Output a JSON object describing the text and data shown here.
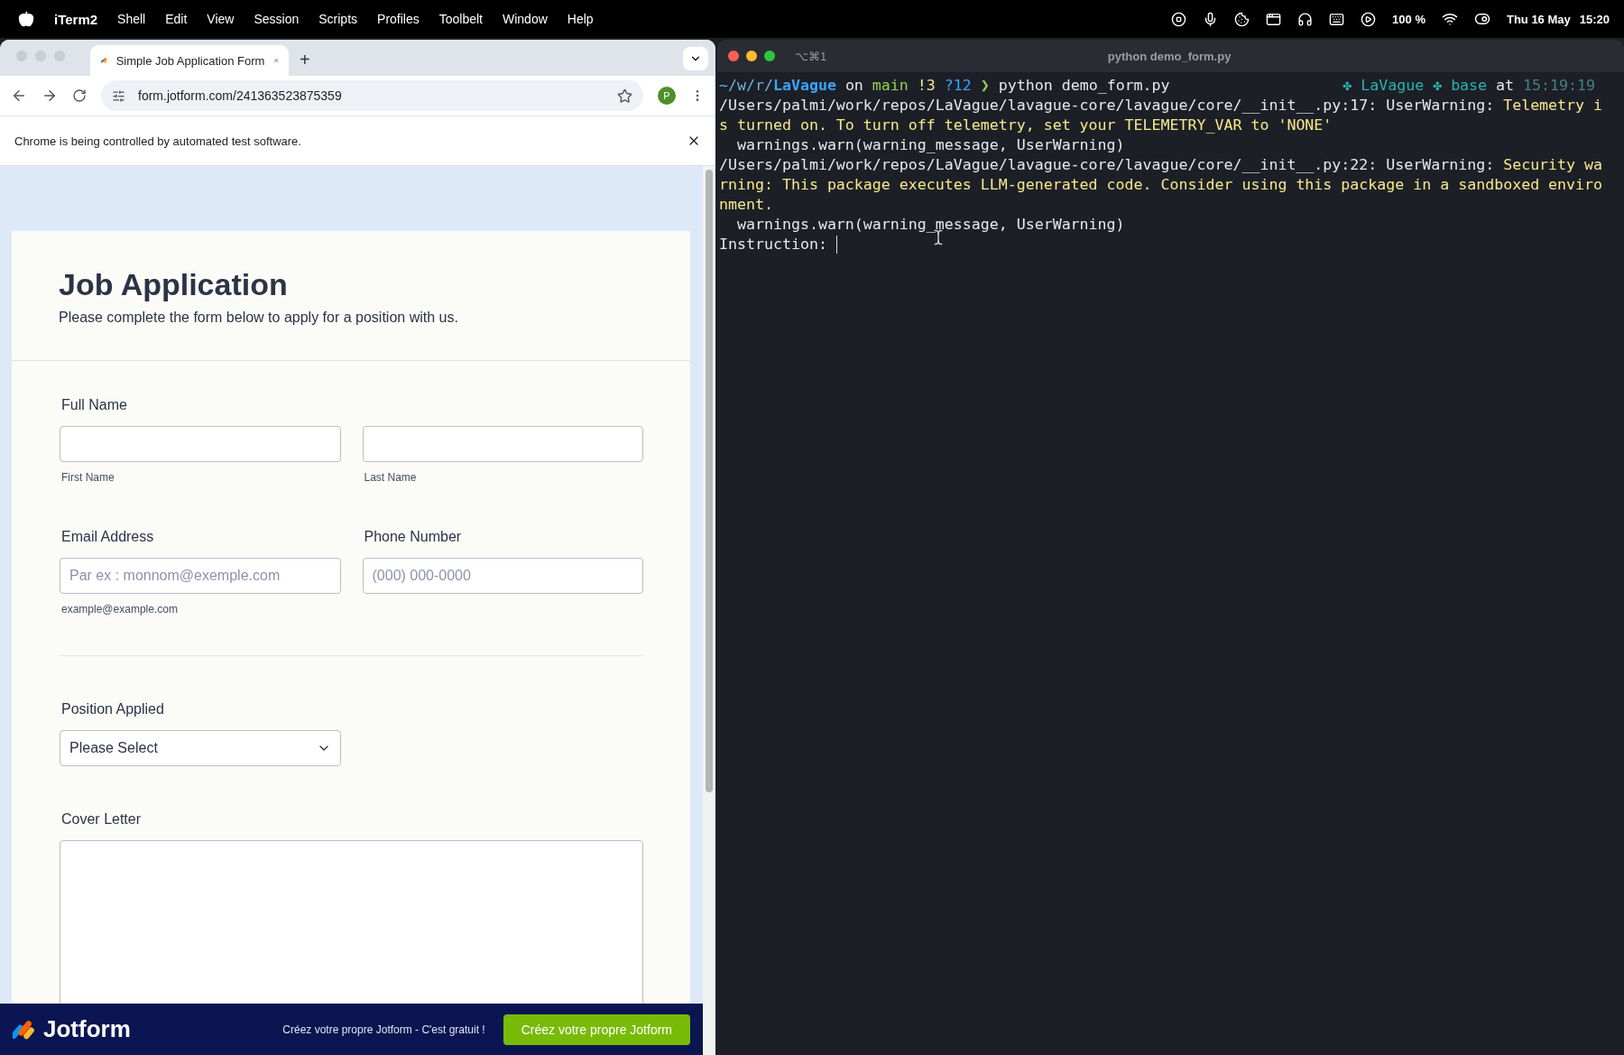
{
  "menubar": {
    "app": "iTerm2",
    "menus": [
      "Shell",
      "Edit",
      "View",
      "Session",
      "Scripts",
      "Profiles",
      "Toolbelt",
      "Window",
      "Help"
    ],
    "battery": "100 %",
    "date": "Thu 16 May",
    "time": "15:20"
  },
  "browser": {
    "tabs": [
      {
        "title": "Simple Job Application Form",
        "selected": true
      }
    ],
    "new_tab": "+",
    "url": "form.jotform.com/241363523875359",
    "profile": "P",
    "infobar": "Chrome is being controlled by automated test software.",
    "form": {
      "title": "Job Application",
      "subtitle": "Please complete the form below to apply for a position with us.",
      "full_name": {
        "label": "Full Name",
        "fields": [
          {
            "sublabel": "First Name"
          },
          {
            "sublabel": "Last Name"
          }
        ]
      },
      "email": {
        "label": "Email Address",
        "placeholder": "Par ex : monnom@exemple.com",
        "sublabel": "example@example.com"
      },
      "phone": {
        "label": "Phone Number",
        "placeholder": "(000) 000-0000"
      },
      "position": {
        "label": "Position Applied",
        "value": "Please Select"
      },
      "cover_letter": {
        "label": "Cover Letter"
      }
    },
    "footer": {
      "brand": "Jotform",
      "promo": "Créez votre propre Jotform - C'est gratuit !",
      "button": "Créez votre propre Jotform"
    }
  },
  "terminal": {
    "shortcut": "⌥⌘1",
    "title": "python demo_form.py",
    "prompt": {
      "left": [
        {
          "text": "~/w/r/",
          "color": "#6fb3e0"
        },
        {
          "text": "LaVague",
          "color": "#39a6ff"
        },
        {
          "text": " on ",
          "color": "#e8e8e8"
        },
        {
          "text": "main",
          "color": "#8fd14f"
        },
        {
          "text": " !3",
          "color": "#f5e98a"
        },
        {
          "text": " ?12",
          "color": "#39a6ff"
        },
        {
          "text": " ❯ ",
          "color": "#8fd14f"
        },
        {
          "text": "python demo_form.py",
          "color": "#e8e8e8"
        }
      ],
      "right": [
        {
          "text": "✤ LaVague",
          "color": "#27b3b0"
        },
        {
          "text": " ✤ base",
          "color": "#27b3b0"
        },
        {
          "text": " at ",
          "color": "#e8e8e8"
        },
        {
          "text": "15:19:19",
          "color": "#45807f"
        }
      ]
    },
    "lines": [
      [
        {
          "text": "/Users/palmi/work/repos/LaVague/lavague-core/lavague/core/__init__.py:17: UserWarning: ",
          "color": "#e8e8e8"
        },
        {
          "text": "Telemetry i",
          "color": "#f5e98a"
        }
      ],
      [
        {
          "text": "s turned on. To turn off telemetry, set your TELEMETRY_VAR to 'NONE'",
          "color": "#f5e98a"
        }
      ],
      [
        {
          "text": "  warnings.warn(warning_message, UserWarning)",
          "color": "#e8e8e8"
        }
      ],
      [
        {
          "text": "/Users/palmi/work/repos/LaVague/lavague-core/lavague/core/__init__.py:22: UserWarning: ",
          "color": "#e8e8e8"
        },
        {
          "text": "Security wa",
          "color": "#f5e98a"
        }
      ],
      [
        {
          "text": "rning: This package executes LLM-generated code. Consider using this package in a sandboxed enviro",
          "color": "#f5e98a"
        }
      ],
      [
        {
          "text": "nment.",
          "color": "#f5e98a"
        }
      ],
      [
        {
          "text": "  warnings.warn(warning_message, UserWarning)",
          "color": "#e8e8e8"
        }
      ],
      [
        {
          "text": "Instruction: ",
          "color": "#e8e8e8"
        }
      ]
    ]
  }
}
